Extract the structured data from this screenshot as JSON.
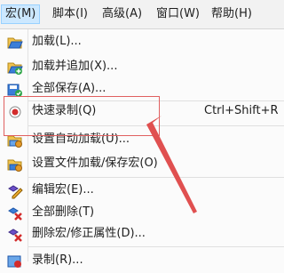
{
  "menubar": {
    "items": [
      {
        "label": "宏(M)"
      },
      {
        "label": "脚本(I)"
      },
      {
        "label": "高级(A)"
      },
      {
        "label": "窗口(W)"
      },
      {
        "label": "帮助(H)"
      }
    ]
  },
  "dropdown": {
    "items": [
      {
        "label": "加载(L)...",
        "icon": "folder-open-icon"
      },
      {
        "label": "加载并追加(X)...",
        "icon": "folder-add-icon"
      },
      {
        "label": "全部保存(A)...",
        "icon": "save-all-icon"
      },
      {
        "label": "快速录制(Q)",
        "shortcut": "Ctrl+Shift+R",
        "icon": "record-icon"
      },
      {
        "label": "设置自动加载(U)...",
        "icon": "autoload-settings-icon"
      },
      {
        "label": "设置文件加载/保存宏(O)",
        "icon": "file-settings-icon"
      },
      {
        "label": "编辑宏(E)...",
        "icon": "edit-macro-icon"
      },
      {
        "label": "全部删除(T)",
        "icon": "delete-all-icon"
      },
      {
        "label": "删除宏/修正属性(D)...",
        "icon": "delete-macro-icon"
      },
      {
        "label": "录制(R)...",
        "icon": "record-macro-icon"
      }
    ]
  },
  "colors": {
    "highlight_border": "#e06060",
    "arrow": "#e05050",
    "active_menu_bg": "#cce8ff"
  }
}
